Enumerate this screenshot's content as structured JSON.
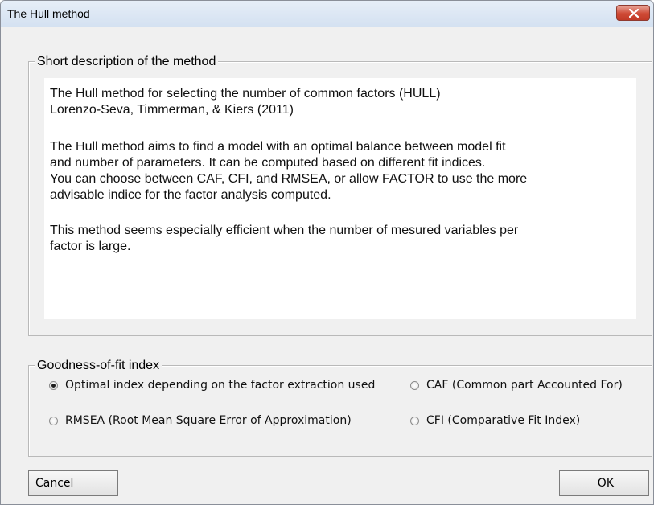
{
  "window": {
    "title": "The Hull method",
    "close_icon": "close-icon"
  },
  "description": {
    "legend": "Short description of the method",
    "lines": [
      "The Hull method for selecting the number of common factors (HULL)",
      "Lorenzo-Seva, Timmerman, & Kiers (2011)",
      "",
      "The Hull method aims to find a model with an optimal balance between model fit",
      "and number of parameters. It can be computed based on different fit indices.",
      "You can choose between CAF, CFI, and RMSEA, or allow FACTOR to use the more",
      "advisable indice for the factor analysis computed.",
      "",
      "This method seems especially efficient when the number of mesured variables per",
      "factor is large."
    ]
  },
  "goodness_of_fit": {
    "legend": "Goodness-of-fit index",
    "options": [
      {
        "label": "Optimal index depending on the factor extraction used",
        "checked": true
      },
      {
        "label": "CAF (Common part Accounted For)",
        "checked": false
      },
      {
        "label": "RMSEA (Root Mean Square Error of Approximation)",
        "checked": false
      },
      {
        "label": "CFI (Comparative Fit Index)",
        "checked": false
      }
    ]
  },
  "buttons": {
    "cancel": "Cancel",
    "ok": "OK"
  }
}
